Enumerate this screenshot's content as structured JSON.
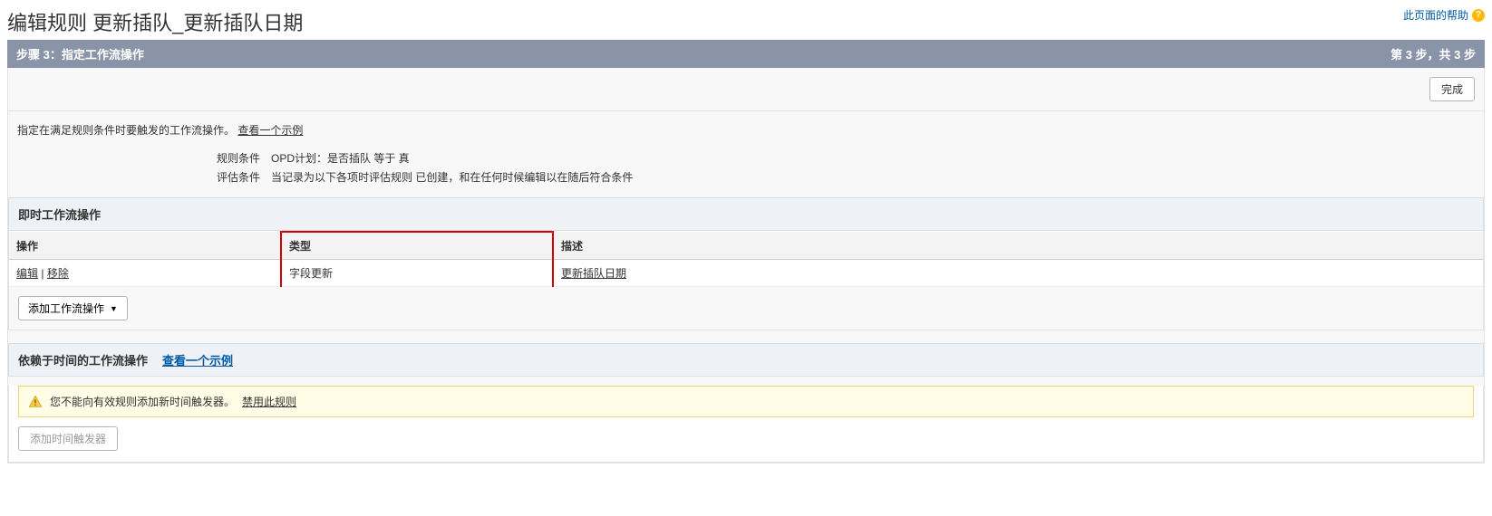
{
  "help_link": "此页面的帮助",
  "page_title": "编辑规则 更新插队_更新插队日期",
  "step_header": {
    "left": "步骤 3：指定工作流操作",
    "right": "第 3 步，共 3 步"
  },
  "done_button": "完成",
  "instruction": {
    "text": "指定在满足规则条件时要触发的工作流操作。 ",
    "link": "查看一个示例"
  },
  "conditions": {
    "rule_label": "规则条件",
    "rule_value": "OPD计划：是否插队 等于 真",
    "eval_label": "评估条件",
    "eval_value": "当记录为以下各项时评估规则 已创建，和在任何时候编辑以在随后符合条件"
  },
  "immediate": {
    "title": "即时工作流操作",
    "columns": {
      "action": "操作",
      "type": "类型",
      "description": "描述"
    },
    "row": {
      "edit": "编辑",
      "remove": "移除",
      "type": "字段更新",
      "description": "更新插队日期"
    },
    "add_button": "添加工作流操作"
  },
  "timed": {
    "title": "依赖于时间的工作流操作",
    "example_link": "查看一个示例",
    "warning_text": "您不能向有效规则添加新时间触发器。 ",
    "disable_link": "禁用此规则",
    "add_trigger": "添加时间触发器"
  }
}
